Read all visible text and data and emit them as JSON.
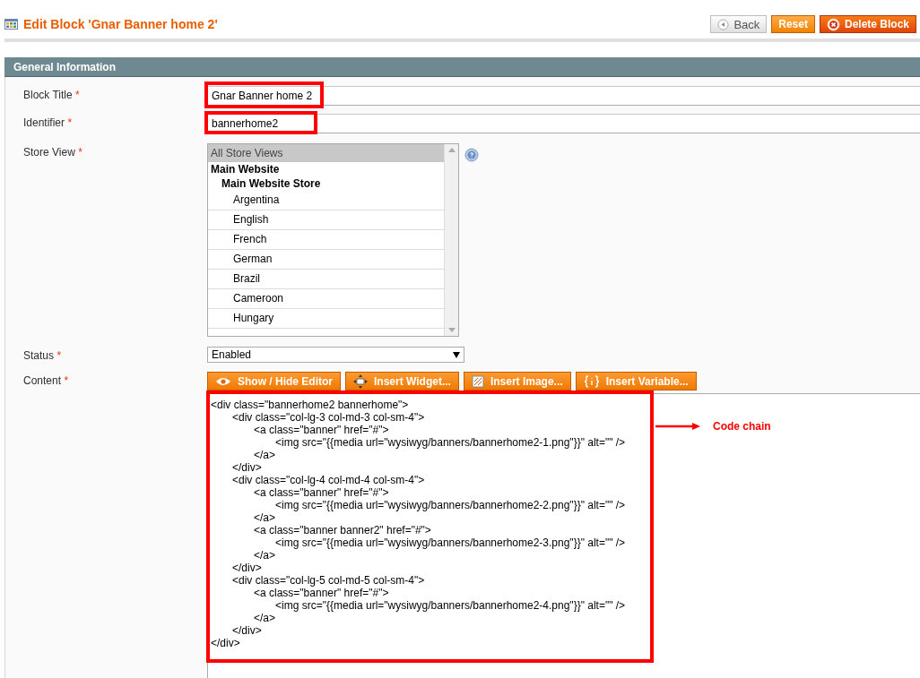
{
  "header": {
    "title": "Edit Block 'Gnar Banner home 2'",
    "buttons": [
      {
        "label": "Back",
        "kind": "back"
      },
      {
        "label": "Reset",
        "kind": "reset"
      },
      {
        "label": "Delete Block",
        "kind": "delete"
      }
    ]
  },
  "section": {
    "title": "General Information"
  },
  "fields": [
    {
      "kind": "text",
      "label": "Block Title",
      "required_mark": "*",
      "value": "Gnar Banner home 2",
      "highlighted": true
    },
    {
      "kind": "text",
      "label": "Identifier",
      "required_mark": "*",
      "value": "bannerhome2",
      "highlighted": true
    },
    {
      "kind": "multiselect",
      "label": "Store View",
      "required_mark": "*",
      "options": [
        {
          "label": "All Store Views",
          "kind": "all",
          "selected": true
        },
        {
          "label": "Main Website",
          "kind": "website",
          "selected": false
        },
        {
          "label": "Main Website Store",
          "kind": "store",
          "selected": false
        },
        {
          "label": "Argentina",
          "kind": "view",
          "selected": false
        },
        {
          "label": "English",
          "kind": "view",
          "selected": false
        },
        {
          "label": "French",
          "kind": "view",
          "selected": false
        },
        {
          "label": "German",
          "kind": "view",
          "selected": false
        },
        {
          "label": "Brazil",
          "kind": "view",
          "selected": false
        },
        {
          "label": "Cameroon",
          "kind": "view",
          "selected": false
        },
        {
          "label": "Hungary",
          "kind": "view",
          "selected": false
        }
      ]
    },
    {
      "kind": "select",
      "label": "Status",
      "required_mark": "*",
      "value": "Enabled"
    },
    {
      "kind": "editor",
      "label": "Content",
      "required_mark": "*",
      "highlighted": true,
      "annotation": "Code chain",
      "buttons": [
        {
          "label": "Show / Hide Editor",
          "kind": "eye"
        },
        {
          "label": "Insert Widget...",
          "kind": "widget"
        },
        {
          "label": "Insert Image...",
          "kind": "image"
        },
        {
          "label": "Insert Variable...",
          "kind": "variable"
        }
      ],
      "code_lines": [
        "<div class=\"bannerhome2 bannerhome\">",
        "\t<div class=\"col-lg-3 col-md-3 col-sm-4\">",
        "\t\t<a class=\"banner\" href=\"#\">",
        "\t\t\t<img src=\"{{media url=\"wysiwyg/banners/bannerhome2-1.png\"}}\" alt=\"\" />",
        "\t\t</a>",
        "\t</div>",
        "\t<div class=\"col-lg-4 col-md-4 col-sm-4\">",
        "\t\t<a class=\"banner\" href=\"#\">",
        "\t\t\t<img src=\"{{media url=\"wysiwyg/banners/bannerhome2-2.png\"}}\" alt=\"\" />",
        "\t\t</a>",
        "\t\t<a class=\"banner banner2\" href=\"#\">",
        "\t\t\t<img src=\"{{media url=\"wysiwyg/banners/bannerhome2-3.png\"}}\" alt=\"\" />",
        "\t\t</a>",
        "\t</div>",
        "\t<div class=\"col-lg-5 col-md-5 col-sm-4\">",
        "\t\t<a class=\"banner\" href=\"#\">",
        "\t\t\t<img src=\"{{media url=\"wysiwyg/banners/bannerhome2-4.png\"}}\" alt=\"\" />",
        "\t\t</a>",
        "\t</div>",
        "</div>"
      ]
    }
  ]
}
